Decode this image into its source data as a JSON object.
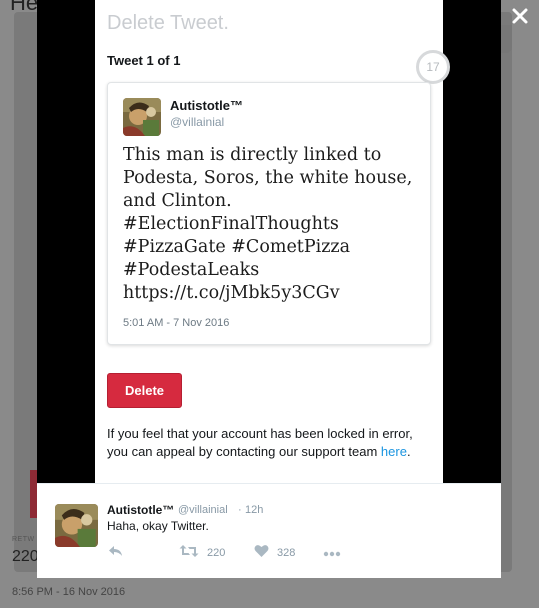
{
  "background": {
    "title_fragment": "He",
    "stat_label": "RETW",
    "stat_value": "220",
    "timestamp": "8:56 PM - 16 Nov 2016"
  },
  "modal": {
    "title": "Delete Tweet.",
    "tweet_counter": "Tweet 1 of 1",
    "circle_count": "17",
    "tweet": {
      "author_name": "Autistotle™",
      "author_handle": "@villainial",
      "text": "This man is directly linked to\nPodesta, Soros, the white house,\nand Clinton.\n#ElectionFinalThoughts\n#PizzaGate #CometPizza\n#PodestaLeaks\nhttps://t.co/jMbk5y3CGv",
      "time": "5:01 AM - 7 Nov 2016"
    },
    "delete_label": "Delete",
    "appeal_text": "If you feel that your account has been locked in error, you can appeal by contacting our support team ",
    "appeal_link": "here",
    "appeal_end": "."
  },
  "reply": {
    "author_name": "Autistotle™",
    "author_handle": "@villainial",
    "separator": "·",
    "time": "12h",
    "text": "Haha, okay Twitter.",
    "retweets": "220",
    "likes": "328"
  },
  "colors": {
    "delete_red": "#d62a3f",
    "link_blue": "#1b95e0",
    "action_gray": "#8899a6"
  },
  "icons": [
    "close-icon",
    "reply-icon",
    "retweet-icon",
    "heart-icon",
    "more-icon"
  ]
}
